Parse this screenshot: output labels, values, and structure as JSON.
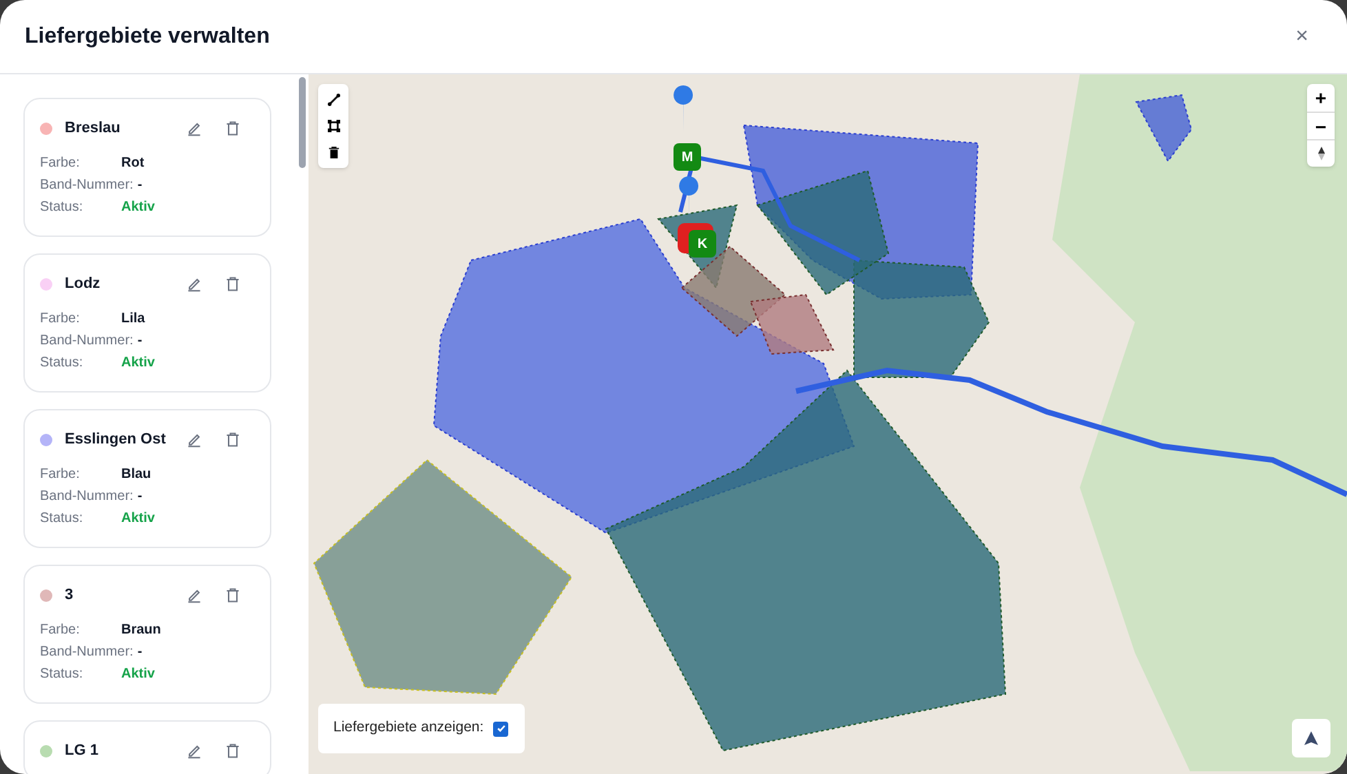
{
  "dialog": {
    "title": "Liefergebiete verwalten",
    "close": "×"
  },
  "areas": [
    {
      "name": "Breslau",
      "color": "#f8b4b4",
      "fields": [
        {
          "label": "Farbe:",
          "value": "Rot",
          "kind": "plain"
        },
        {
          "label": "Band-Nummer:",
          "value": "-",
          "kind": "plain"
        },
        {
          "label": "Status:",
          "value": "Aktiv",
          "kind": "status"
        }
      ]
    },
    {
      "name": "Lodz",
      "color": "#f9d0f5",
      "fields": [
        {
          "label": "Farbe:",
          "value": "Lila",
          "kind": "plain"
        },
        {
          "label": "Band-Nummer:",
          "value": "-",
          "kind": "plain"
        },
        {
          "label": "Status:",
          "value": "Aktiv",
          "kind": "status"
        }
      ]
    },
    {
      "name": "Esslingen Ost",
      "color": "#b4b4f8",
      "fields": [
        {
          "label": "Farbe:",
          "value": "Blau",
          "kind": "plain"
        },
        {
          "label": "Band-Nummer:",
          "value": "-",
          "kind": "plain"
        },
        {
          "label": "Status:",
          "value": "Aktiv",
          "kind": "status"
        }
      ]
    },
    {
      "name": "3",
      "color": "#e0b8b8",
      "fields": [
        {
          "label": "Farbe:",
          "value": "Braun",
          "kind": "plain"
        },
        {
          "label": "Band-Nummer:",
          "value": "-",
          "kind": "plain"
        },
        {
          "label": "Status:",
          "value": "Aktiv",
          "kind": "status"
        }
      ]
    },
    {
      "name": "LG 1",
      "color": "#b8dcb0"
    }
  ],
  "map": {
    "zoom_in": "+",
    "zoom_out": "−",
    "show_areas": {
      "label": "Liefergebiete anzeigen:",
      "checked": true
    },
    "markers": [
      {
        "label": "M",
        "color": "#138a13"
      },
      {
        "label": "K",
        "color": "#138a13"
      }
    ]
  }
}
